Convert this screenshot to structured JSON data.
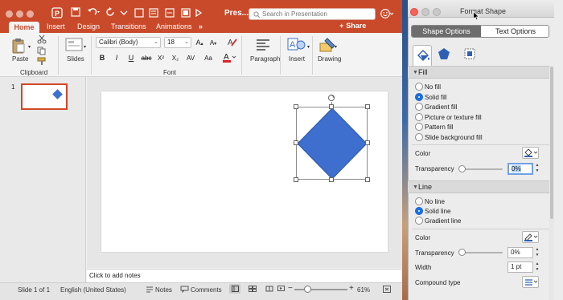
{
  "app": {
    "doc_title": "Pres...",
    "search_placeholder": "Search in Presentation"
  },
  "ribbon": {
    "tabs": [
      "Home",
      "Insert",
      "Design",
      "Transitions",
      "Animations"
    ],
    "more": "»",
    "share": "Share",
    "paste_label": "Paste",
    "slides_label": "Slides",
    "clipboard_label": "Clipboard",
    "font_name": "Calibri (Body)",
    "font_size": "18",
    "font_label": "Font",
    "paragraph_label": "Paragraph",
    "insert_label": "Insert",
    "drawing_label": "Drawing",
    "format_buttons": [
      "B",
      "I",
      "U",
      "abc",
      "X²",
      "X₂",
      "AV",
      "Aa",
      "A"
    ]
  },
  "thumbnails": {
    "slide_number": "1"
  },
  "notes": {
    "placeholder": "Click to add notes"
  },
  "status": {
    "slide_info": "Slide 1 of 1",
    "language": "English (United States)",
    "notes_btn": "Notes",
    "comments_btn": "Comments",
    "zoom": "61%",
    "zoom_level": 0.61
  },
  "panel": {
    "title": "Format Shape",
    "tabs": {
      "shape_options": "Shape Options",
      "text_options": "Text Options"
    },
    "fill": {
      "header": "Fill",
      "options": [
        "No fill",
        "Solid fill",
        "Gradient fill",
        "Picture or texture fill",
        "Pattern fill",
        "Slide background fill"
      ],
      "selected_index": 1,
      "color_label": "Color",
      "transparency_label": "Transparency",
      "transparency_value": "0%"
    },
    "line": {
      "header": "Line",
      "options": [
        "No line",
        "Solid line",
        "Gradient line"
      ],
      "selected_index": 1,
      "color_label": "Color",
      "transparency_label": "Transparency",
      "transparency_value": "0%",
      "width_label": "Width",
      "width_value": "1 pt",
      "compound_label": "Compound type"
    }
  },
  "colors": {
    "brand_red": "#c94a2a",
    "shape_blue": "#3f6fce",
    "fill_bucket_blue": "#2f5fb5",
    "selected_radio": "#1a73e8"
  },
  "icons": [
    "close-icon",
    "minimize-icon",
    "zoom-icon",
    "save-icon",
    "undo-icon",
    "redo-icon",
    "search-icon",
    "smiley-icon",
    "share-icon",
    "cut-icon",
    "copy-icon",
    "format-painter-icon",
    "paint-bucket-icon",
    "pentagon-icon",
    "size-properties-icon",
    "pen-icon",
    "rotate-handle-icon"
  ]
}
